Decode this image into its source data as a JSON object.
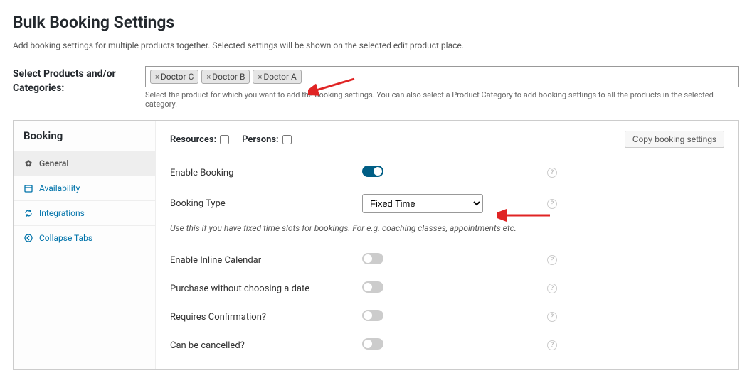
{
  "page": {
    "title": "Bulk Booking Settings",
    "subtitle": "Add booking settings for multiple products together. Selected settings will be shown on the selected edit product place."
  },
  "select_products": {
    "label": "Select Products and/or Categories:",
    "chips": [
      "Doctor C",
      "Doctor B",
      "Doctor A"
    ],
    "hint": "Select the product for which you want to add the booking settings. You can also select a Product Category to add booking settings to all the products in the selected category."
  },
  "sidebar": {
    "title": "Booking",
    "items": [
      {
        "icon": "gear-icon",
        "label": "General",
        "active": true
      },
      {
        "icon": "calendar-icon",
        "label": "Availability",
        "active": false
      },
      {
        "icon": "refresh-icon",
        "label": "Integrations",
        "active": false
      },
      {
        "icon": "collapse-icon",
        "label": "Collapse Tabs",
        "active": false
      }
    ]
  },
  "topbar": {
    "resources_label": "Resources:",
    "persons_label": "Persons:",
    "copy_button": "Copy booking settings"
  },
  "form": {
    "enable_booking": {
      "label": "Enable Booking",
      "value": true
    },
    "booking_type": {
      "label": "Booking Type",
      "value": "Fixed Time",
      "desc": "Use this if you have fixed time slots for bookings. For e.g. coaching classes, appointments etc."
    },
    "inline_calendar": {
      "label": "Enable Inline Calendar",
      "value": false
    },
    "purchase_no_date": {
      "label": "Purchase without choosing a date",
      "value": false
    },
    "requires_confirmation": {
      "label": "Requires Confirmation?",
      "value": false
    },
    "can_cancel": {
      "label": "Can be cancelled?",
      "value": false
    }
  }
}
